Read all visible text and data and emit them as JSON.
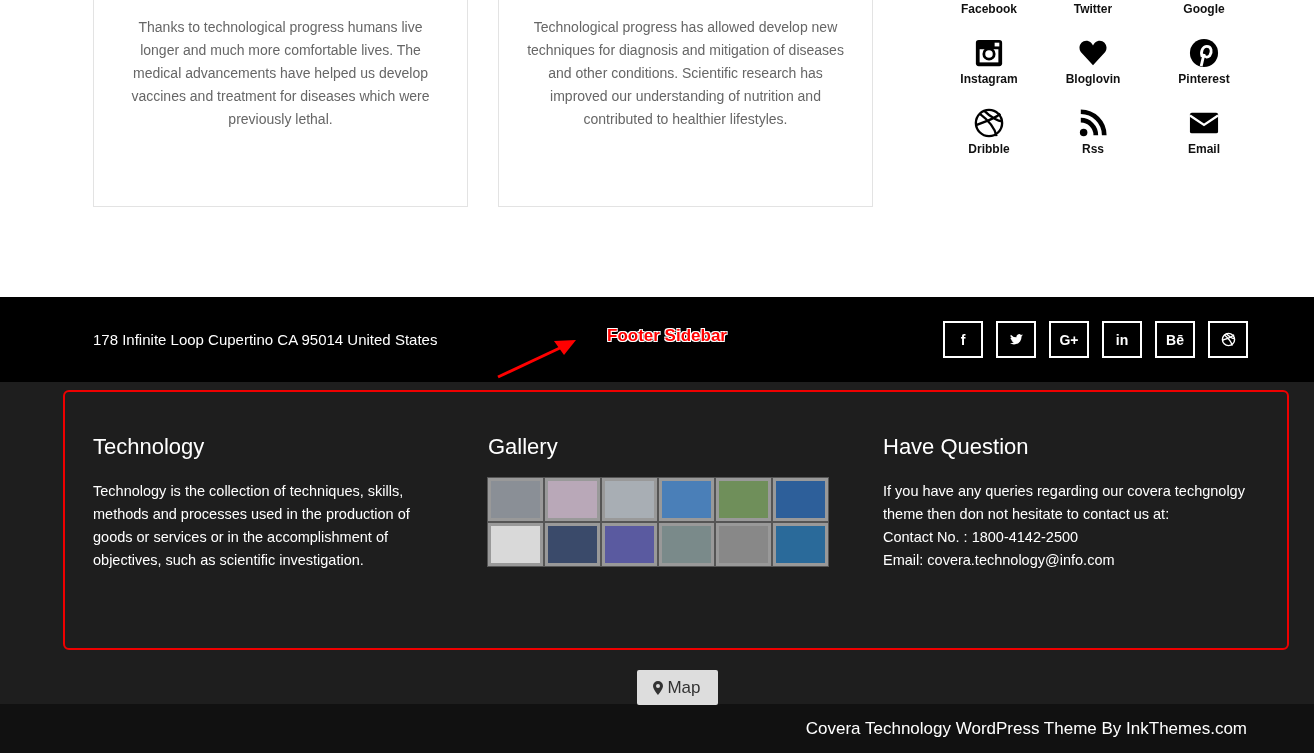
{
  "cards": [
    {
      "text": "Thanks to technological progress humans live longer and much more comfortable lives. The medical advancements have helped us develop vaccines and treatment for diseases which were previously lethal."
    },
    {
      "text": "Technological progress has allowed develop new techniques for diagnosis and mitigation of diseases and other conditions. Scientific research has improved our understanding of nutrition and contributed to healthier lifestyles."
    }
  ],
  "social_grid": [
    {
      "label": "Facebook"
    },
    {
      "label": "Twitter"
    },
    {
      "label": "Google"
    },
    {
      "label": "Instagram",
      "kind": "instagram"
    },
    {
      "label": "Bloglovin",
      "kind": "heart"
    },
    {
      "label": "Pinterest",
      "kind": "pinterest"
    },
    {
      "label": "Dribble",
      "kind": "ball"
    },
    {
      "label": "Rss",
      "kind": "rss"
    },
    {
      "label": "Email",
      "kind": "envelope"
    }
  ],
  "address_bar": {
    "address": "178 Infinite Loop Cupertino CA 95014 United States",
    "annotation": "Footer Sidebar",
    "social_buttons": [
      {
        "kind": "glyph",
        "glyph": "f"
      },
      {
        "kind": "bird"
      },
      {
        "kind": "glyph",
        "glyph": "G+"
      },
      {
        "kind": "glyph",
        "glyph": "in"
      },
      {
        "kind": "glyph",
        "glyph": "Bē"
      },
      {
        "kind": "ball"
      }
    ]
  },
  "footer_sidebar": {
    "technology": {
      "title": "Technology",
      "text": "Technology is the collection of techniques, skills, methods and processes used in the production of goods or services or in the accomplishment of objectives, such as scientific investigation."
    },
    "gallery": {
      "title": "Gallery",
      "photos": [
        {
          "kind": "photo"
        },
        {
          "kind": "photo"
        },
        {
          "kind": "photo"
        },
        {
          "kind": "photo"
        },
        {
          "kind": "photo"
        },
        {
          "kind": "photo"
        },
        {
          "kind": "photo"
        },
        {
          "kind": "photo"
        },
        {
          "kind": "photo"
        },
        {
          "kind": "photo"
        },
        {
          "kind": "photo"
        },
        {
          "kind": "photo"
        }
      ]
    },
    "question": {
      "title": "Have Question",
      "lines": [
        "If you have any queries regarding our covera techgnolgy theme then don not hesitate to contact us at:",
        "Contact No. : 1800-4142-2500",
        "Email: covera.technology@info.com"
      ]
    }
  },
  "map_button": "Map",
  "copyright": "Covera Technology WordPress Theme By InkThemes.com"
}
